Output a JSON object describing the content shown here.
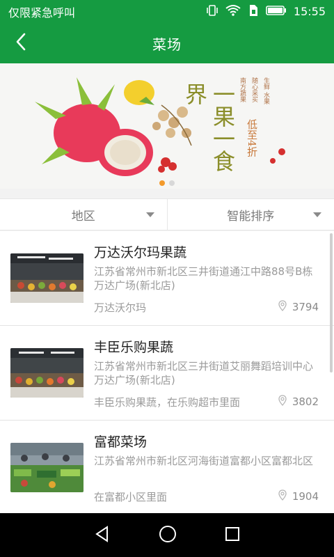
{
  "status_bar": {
    "carrier": "仅限紧急呼叫",
    "time": "15:55",
    "icons": [
      "vibrate-icon",
      "wifi-icon",
      "sim-icon",
      "battery-icon"
    ]
  },
  "app_bar": {
    "title": "菜场",
    "back_icon": "back-chevron-icon"
  },
  "banner": {
    "headline": "一果一食界",
    "promo": "低至4折",
    "small_lines": [
      "生鲜 水果",
      "随心采买",
      "南方蔬果"
    ],
    "page_count": 2,
    "active_page": 1
  },
  "filters": [
    {
      "label": "地区"
    },
    {
      "label": "智能排序"
    }
  ],
  "markets": [
    {
      "name": "万达沃尔玛果蔬",
      "address": "江苏省常州市新北区三井街道通江中路88号B栋万达广场(新北店)",
      "note": "万达沃尔玛",
      "distance": "3794"
    },
    {
      "name": "丰臣乐购果蔬",
      "address": "江苏省常州市新北区三井街道艾丽舞蹈培训中心万达广场(新北店)",
      "note": "丰臣乐购果蔬，在乐购超市里面",
      "distance": "3802"
    },
    {
      "name": "富都菜场",
      "address": "江苏省常州市新北区河海街道富都小区富都北区",
      "note": "在富都小区里面",
      "distance": "1904"
    }
  ],
  "colors": {
    "primary": "#159b41",
    "accent_dot": "#f39a2b"
  },
  "nav_bar": {
    "icons": [
      "back-triangle-icon",
      "home-circle-icon",
      "recents-square-icon"
    ]
  }
}
